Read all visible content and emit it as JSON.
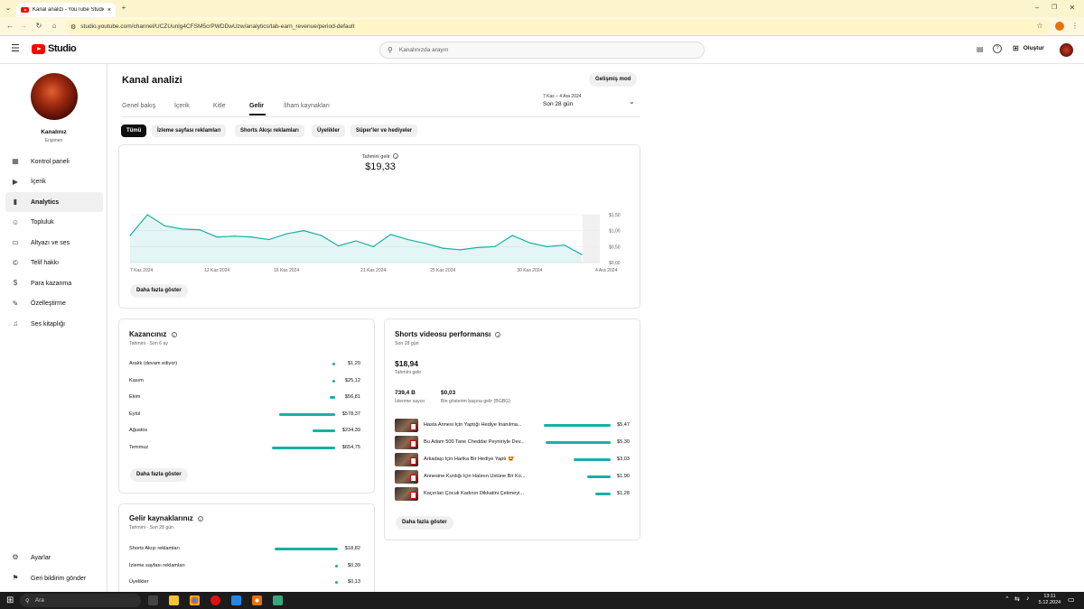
{
  "browser": {
    "tab_title": "Kanal analizi - YouTube Studio",
    "url": "studio.youtube.com/channel/UCZUunlg4CFSM5crPWDDwUzw/analytics/tab-earn_revenue/period-default"
  },
  "header": {
    "logo_text": "Studio",
    "search_placeholder": "Kanalınızda arayın",
    "create_label": "Oluştur"
  },
  "sidebar": {
    "channel_name": "Kanalınız",
    "channel_sub": "Erişimen",
    "items": [
      {
        "label": "Kontrol paneli",
        "icon": "dashboard-icon"
      },
      {
        "label": "İçerik",
        "icon": "content-icon"
      },
      {
        "label": "Analytics",
        "icon": "analytics-icon"
      },
      {
        "label": "Topluluk",
        "icon": "community-icon"
      },
      {
        "label": "Altyazı ve ses",
        "icon": "subtitles-icon"
      },
      {
        "label": "Telif hakkı",
        "icon": "copyright-icon"
      },
      {
        "label": "Para kazanma",
        "icon": "dollar-icon"
      },
      {
        "label": "Özelleştirme",
        "icon": "customization-icon"
      },
      {
        "label": "Ses kitaplığı",
        "icon": "audio-library-icon"
      }
    ],
    "settings_label": "Ayarlar",
    "feedback_label": "Geri bildirim gönder"
  },
  "page": {
    "title": "Kanal analizi",
    "advanced_mode": "Gelişmiş mod",
    "tabs": [
      "Genel bakış",
      "İçerik",
      "Kitle",
      "Gelir",
      "İlham kaynakları"
    ],
    "active_tab": 3,
    "date_range": "7 Kas – 4 Ara 2024",
    "period": "Son 28 gün",
    "chips": [
      "Tümü",
      "İzleme sayfası reklamları",
      "Shorts Akışı reklamları",
      "Üyelikler",
      "Süper'ler ve hediyeler"
    ]
  },
  "revenue_chart": {
    "label": "Tahmini gelir",
    "total": "$19,33",
    "show_more": "Daha fazla göster"
  },
  "chart_data": {
    "type": "area",
    "x": [
      "7 Kas 2024",
      "8 Kas",
      "9 Kas",
      "10 Kas",
      "11 Kas",
      "12 Kas 2024",
      "13 Kas",
      "14 Kas",
      "15 Kas",
      "16 Kas 2024",
      "17 Kas",
      "18 Kas",
      "19 Kas",
      "20 Kas",
      "21 Kas 2024",
      "22 Kas",
      "23 Kas",
      "24 Kas",
      "25 Kas 2024",
      "26 Kas",
      "27 Kas",
      "28 Kas",
      "29 Kas",
      "30 Kas 2024",
      "1 Ara",
      "2 Ara",
      "3 Ara",
      "4 Ara 2024"
    ],
    "x_ticks": [
      "7 Kas 2024",
      "12 Kas 2024",
      "16 Kas 2024",
      "21 Kas 2024",
      "25 Kas 2024",
      "30 Kas 2024",
      "4 Ara 2024"
    ],
    "y_ticks": [
      "$1,50",
      "$1,00",
      "$0,50",
      "$0,00"
    ],
    "ylim": [
      0,
      1.5
    ],
    "series": [
      {
        "values": [
          0.85,
          1.5,
          1.15,
          1.05,
          1.03,
          0.8,
          0.83,
          0.8,
          0.72,
          0.9,
          1.0,
          0.85,
          0.52,
          0.68,
          0.5,
          0.88,
          0.72,
          0.6,
          0.45,
          0.4,
          0.47,
          0.5,
          0.85,
          0.62,
          0.5,
          0.55,
          0.25
        ]
      }
    ],
    "color": "#16b0a4"
  },
  "earnings": {
    "title": "Kazancınız",
    "subtitle": "Tahmini · Son 6 ay",
    "rows": [
      {
        "label": "Aralık (devam ediyor)",
        "value": "$1,20",
        "fraction": 0.01
      },
      {
        "label": "Kasım",
        "value": "$25,12",
        "fraction": 0.01
      },
      {
        "label": "Ekim",
        "value": "$56,81",
        "fraction": 0.08
      },
      {
        "label": "Eylül",
        "value": "$578,37",
        "fraction": 0.88
      },
      {
        "label": "Ağustos",
        "value": "$234,39",
        "fraction": 0.36
      },
      {
        "label": "Temmuz",
        "value": "$654,75",
        "fraction": 1.0
      }
    ],
    "show_more": "Daha fazla göster"
  },
  "sources": {
    "title": "Gelir kaynaklarınız",
    "subtitle": "Tahmini · Son 28 gün",
    "rows": [
      {
        "label": "Shorts Akışı reklamları",
        "value": "$18,82",
        "fraction": 1.0
      },
      {
        "label": "İzleme sayfası reklamları",
        "value": "$0,39",
        "fraction": 0.02
      },
      {
        "label": "Üyelikler",
        "value": "$0,13",
        "fraction": 0.01
      }
    ]
  },
  "shorts": {
    "title": "Shorts videosu performansı",
    "subtitle": "Son 28 gün",
    "revenue": "$18,94",
    "revenue_label": "Tahmini gelir",
    "views": "739,4 B",
    "views_label": "İzlenme sayısı",
    "rpm": "$0,03",
    "rpm_label": "Bin gösterim başına gelir (BGBG)",
    "rows": [
      {
        "title": "Hasta Annesi İçin Yaptığı Hediye İnanılma...",
        "value": "$5,47",
        "fraction": 1.0
      },
      {
        "title": "Bu Adam 500 Tane Cheddar Peyniriyle Dev...",
        "value": "$5,30",
        "fraction": 0.97
      },
      {
        "title": "Arkadaşı İçin Harika Bir Hediye Yaptı 🤩",
        "value": "$3,03",
        "fraction": 0.55
      },
      {
        "title": "Annesine Kızdığı İçin Halının Üstüne Bir Ko...",
        "value": "$1,90",
        "fraction": 0.35
      },
      {
        "title": "Kaçırılan Çocuk Kadının Dikkatini Çekmeyi...",
        "value": "$1,28",
        "fraction": 0.23
      }
    ],
    "show_more": "Daha fazla göster"
  },
  "taskbar": {
    "search_label": "Ara",
    "time": "13:11",
    "date": "5.12.2024"
  }
}
